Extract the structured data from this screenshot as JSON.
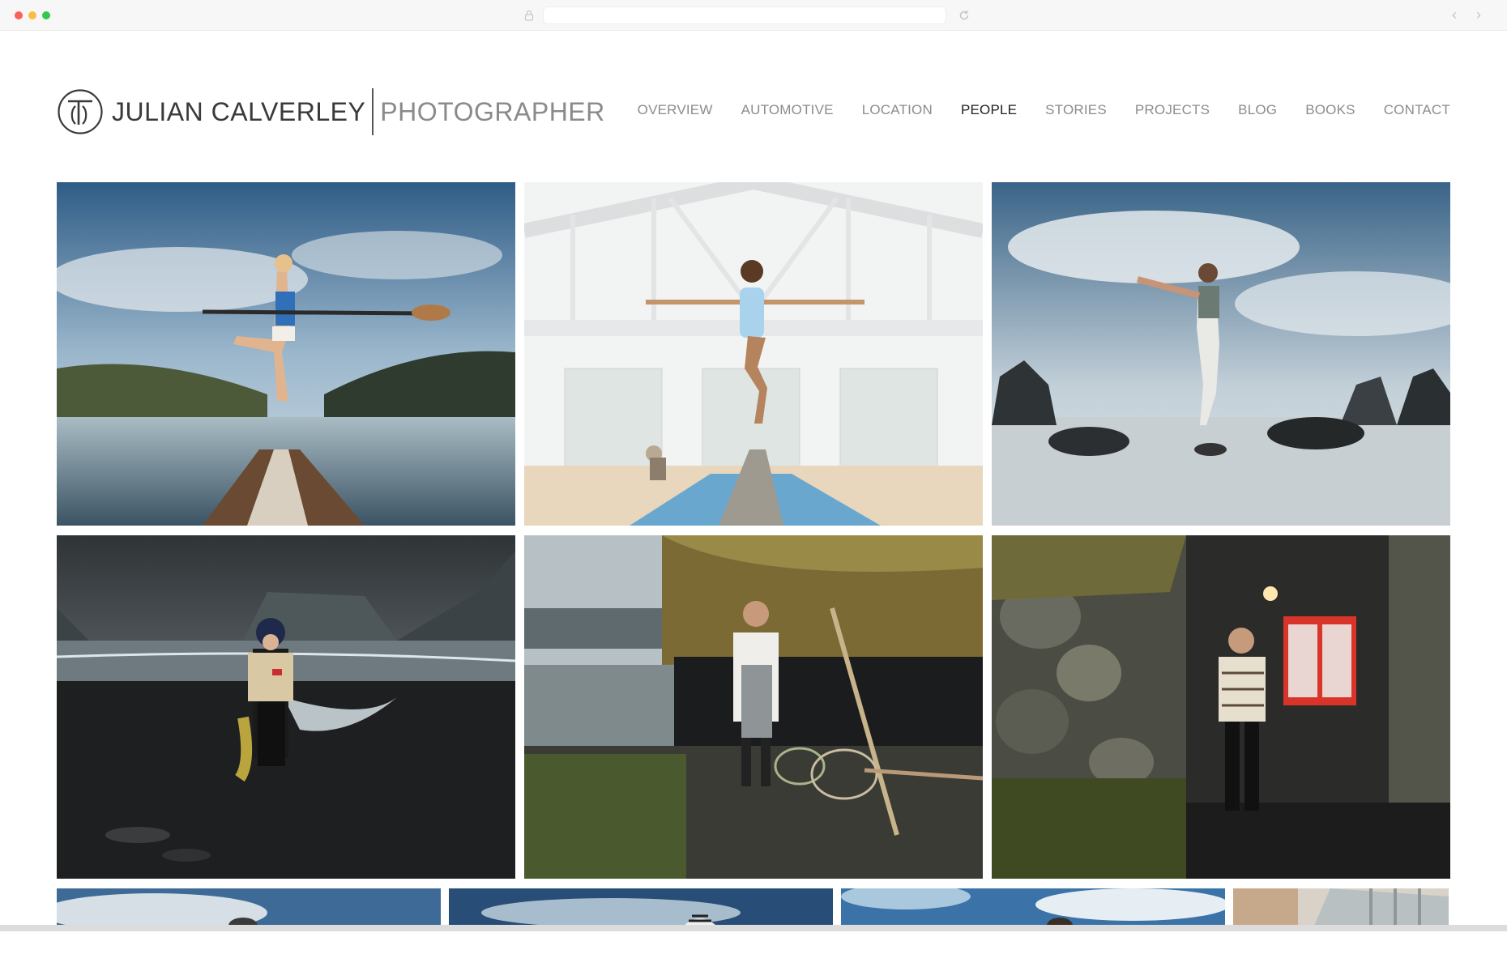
{
  "site": {
    "name": "JULIAN CALVERLEY",
    "title": "PHOTOGRAPHER"
  },
  "nav": {
    "items": [
      {
        "label": "OVERVIEW",
        "active": false
      },
      {
        "label": "AUTOMOTIVE",
        "active": false
      },
      {
        "label": "LOCATION",
        "active": false
      },
      {
        "label": "PEOPLE",
        "active": true
      },
      {
        "label": "STORIES",
        "active": false
      },
      {
        "label": "PROJECTS",
        "active": false
      },
      {
        "label": "BLOG",
        "active": false
      },
      {
        "label": "BOOKS",
        "active": false
      },
      {
        "label": "CONTACT",
        "active": false
      }
    ]
  },
  "gallery": {
    "photos": [
      {
        "subject": "woman balancing on paddleboard with paddle on lake"
      },
      {
        "subject": "girl balancing on beam in white studio"
      },
      {
        "subject": "man in yoga pose on rocky beach"
      },
      {
        "subject": "fisherwoman with net on black sand beach"
      },
      {
        "subject": "chef in apron beside turf-roofed hut"
      },
      {
        "subject": "man in knitted sweater beside stone house with red window"
      }
    ],
    "partial_row_count": 4
  },
  "colors": {
    "nav_text": "#8c8c8c",
    "nav_active": "#222222",
    "logo_text": "#3a3a3a",
    "logo_title": "#8a8a8a"
  }
}
